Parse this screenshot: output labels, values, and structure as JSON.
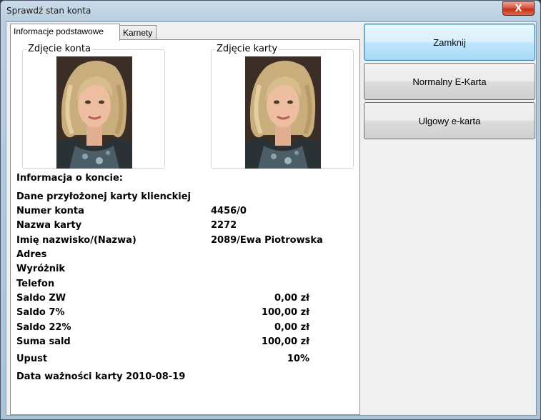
{
  "window": {
    "title": "Sprawdź stan konta",
    "close_glyph": "X"
  },
  "tabs": [
    {
      "label": "Informacje podstawowe",
      "active": true
    },
    {
      "label": "Karnety",
      "active": false
    }
  ],
  "photos": {
    "account_label": "Zdjęcie konta",
    "card_label": "Zdjęcie karty"
  },
  "info": {
    "heading": "Informacja o koncie:",
    "card_data_label": "Dane przyłożonej karty klienckiej",
    "fields": {
      "account_number": {
        "label": "Numer konta",
        "value": "4456/0"
      },
      "card_name": {
        "label": "Nazwa karty",
        "value": "2272"
      },
      "full_name": {
        "label": "Imię nazwisko/(Nazwa)",
        "value": "2089/Ewa Piotrowska"
      },
      "address": {
        "label": "Adres",
        "value": ""
      },
      "distinction": {
        "label": "Wyróżnik",
        "value": ""
      },
      "phone": {
        "label": "Telefon",
        "value": ""
      },
      "balance_zw": {
        "label": "Saldo ZW",
        "value": "0,00 zł"
      },
      "balance_7": {
        "label": "Saldo 7%",
        "value": "100,00 zł"
      },
      "balance_22": {
        "label": "Saldo 22%",
        "value": "0,00 zł"
      },
      "balance_sum": {
        "label": "Suma sald",
        "value": "100,00 zł"
      },
      "discount": {
        "label": "Upust",
        "value": "10%"
      }
    },
    "expiry_line": "Data ważności karty 2010-08-19"
  },
  "buttons": {
    "close": "Zamknij",
    "normal_ecard": "Normalny E-Karta",
    "reduced_ecard": "Ulgowy e-karta"
  }
}
